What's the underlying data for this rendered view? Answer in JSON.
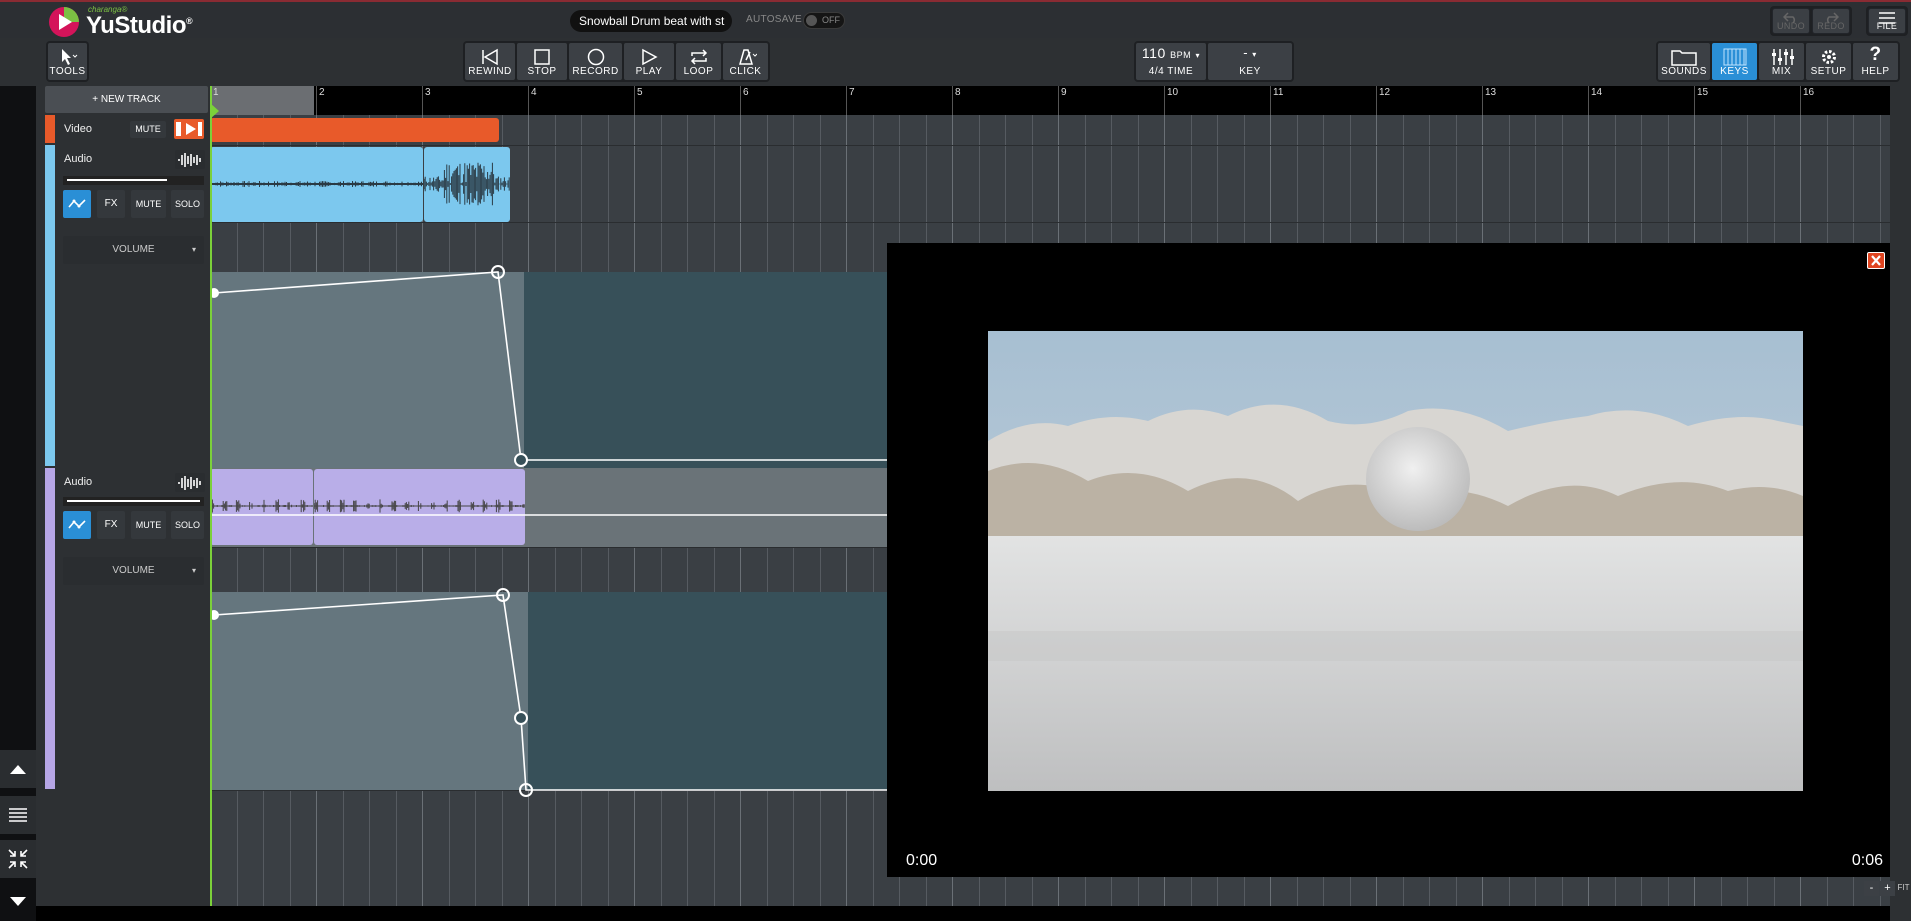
{
  "app": {
    "brand_small": "charanga®",
    "brand": "YuStudio",
    "registered": "®",
    "project_title": "Snowball Drum beat with st",
    "autosave_label": "AUTOSAVE",
    "autosave_state": "OFF"
  },
  "top_right": {
    "undo": "UNDO",
    "redo": "REDO",
    "file": "FILE"
  },
  "toolbar": {
    "tools": "TOOLS",
    "rewind": "REWIND",
    "stop": "STOP",
    "record": "RECORD",
    "play": "PLAY",
    "loop": "LOOP",
    "click": "CLICK",
    "bpm_value": "110",
    "bpm_unit": "BPM",
    "time_sig": "4/4 TIME",
    "key_value": "-",
    "key_label": "KEY",
    "sounds": "SOUNDS",
    "keys": "KEYS",
    "mix": "MIX",
    "setup": "SETUP",
    "help": "HELP"
  },
  "tracks": {
    "new_track": "+ NEW TRACK",
    "video": {
      "name": "Video",
      "mute": "MUTE",
      "color": "#e85a2a"
    },
    "audio1": {
      "name": "Audio",
      "fx": "FX",
      "mute": "MUTE",
      "solo": "SOLO",
      "volume": "VOLUME",
      "color": "#7cc8ee"
    },
    "audio2": {
      "name": "Audio",
      "fx": "FX",
      "mute": "MUTE",
      "solo": "SOLO",
      "volume": "VOLUME",
      "color": "#b6a6e6"
    }
  },
  "ruler": {
    "bars": [
      "1",
      "2",
      "3",
      "4",
      "5",
      "6",
      "7",
      "8",
      "9",
      "10",
      "11",
      "12",
      "13",
      "14",
      "15",
      "16"
    ]
  },
  "video_player": {
    "current_time": "0:00",
    "duration": "0:06",
    "progress": 0.0
  },
  "zoom": {
    "minus": "-",
    "plus": "+",
    "fit": "FIT"
  },
  "colors": {
    "accent_blue": "#2a8fd6",
    "playhead": "#7bd13a",
    "close_red": "#e04420"
  }
}
